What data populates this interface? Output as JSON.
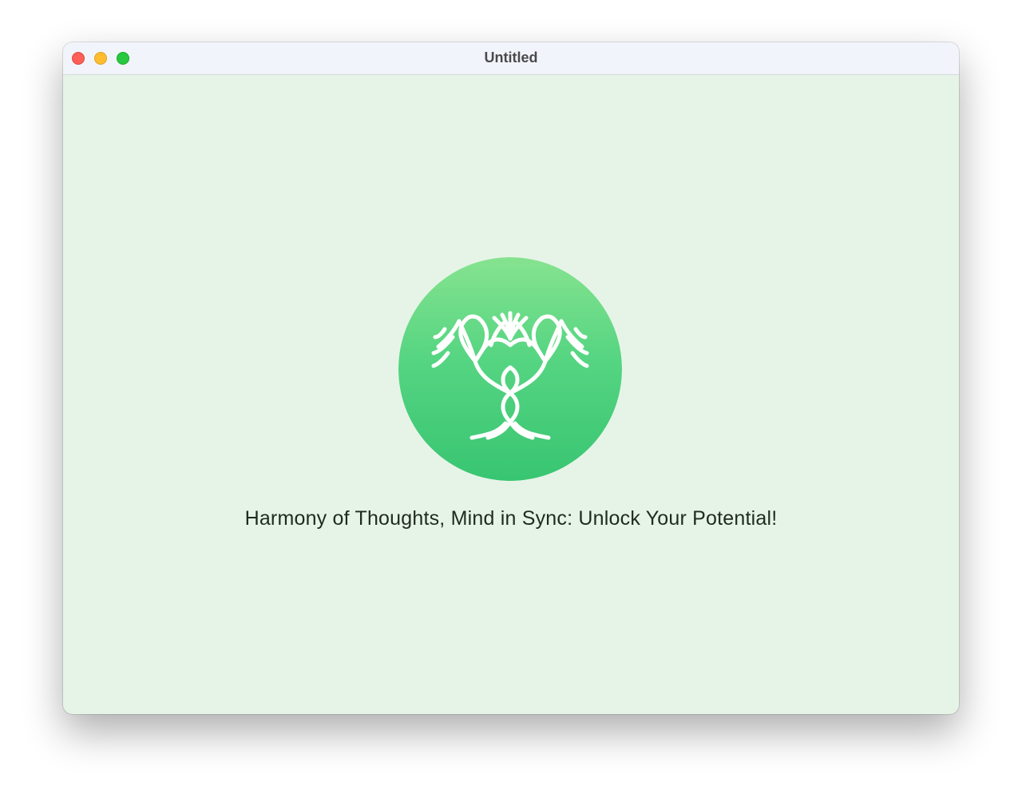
{
  "window": {
    "title": "Untitled",
    "controls": {
      "close": "close-button",
      "minimize": "minimize-button",
      "zoom": "zoom-button"
    }
  },
  "main": {
    "logo": {
      "icon": "tree-icon",
      "colors": {
        "circle_top": "#86e38f",
        "circle_bottom": "#38c572",
        "tree": "#ffffff"
      }
    },
    "tagline": "Harmony of Thoughts, Mind in Sync: Unlock Your Potential!"
  },
  "colors": {
    "background": "#e6f4e7",
    "titlebar": "#f2f4fb",
    "close": "#fe5f57",
    "minimize": "#febc2e",
    "zoom": "#28c840"
  }
}
